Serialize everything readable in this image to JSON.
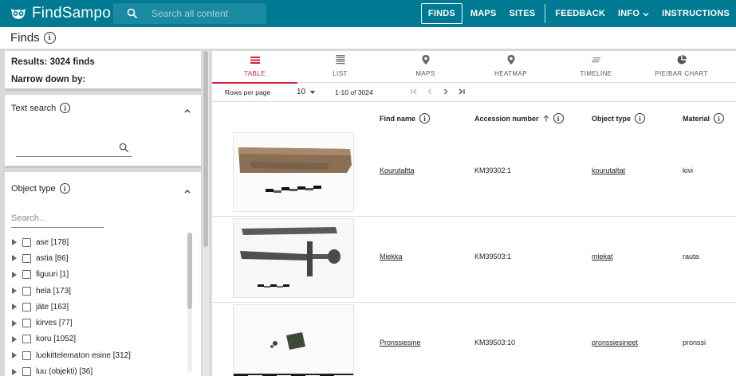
{
  "header": {
    "brand": "FindSampo",
    "search_placeholder": "Search all content",
    "nav": [
      {
        "label": "FINDS",
        "active": true
      },
      {
        "label": "MAPS",
        "active": false
      },
      {
        "label": "SITES",
        "active": false
      },
      {
        "label": "FEEDBACK",
        "active": false
      },
      {
        "label": "INFO",
        "active": false
      },
      {
        "label": "INSTRUCTIONS",
        "active": false
      }
    ],
    "bar_color": "#007a93"
  },
  "page": {
    "title": "Finds"
  },
  "left": {
    "results": "Results: 3024 finds",
    "narrow": "Narrow down by:",
    "text_search": {
      "title": "Text search"
    },
    "object_type": {
      "title": "Object type",
      "search_placeholder": "Search...",
      "items": [
        "ase [178]",
        "astia [86]",
        "figuuri [1]",
        "hela [173]",
        "jäte [163]",
        "kirves [77]",
        "koru [1052]",
        "luokittelematon esine [312]",
        "luu (objekti) [36]"
      ]
    }
  },
  "tabs": [
    {
      "label": "TABLE",
      "icon": "table-icon",
      "active": true
    },
    {
      "label": "LIST",
      "icon": "list-icon",
      "active": false
    },
    {
      "label": "MAPS",
      "icon": "map-pin-icon",
      "active": false
    },
    {
      "label": "HEATMAP",
      "icon": "heatmap-pin-icon",
      "active": false
    },
    {
      "label": "TIMELINE",
      "icon": "timeline-icon",
      "active": false
    },
    {
      "label": "PIE/BAR CHART",
      "icon": "pie-chart-icon",
      "active": false
    }
  ],
  "accent_color": "#d3203f",
  "pager": {
    "rows_per_page_label": "Rows per page",
    "rows_per_page": "10",
    "range": "1-10 of 3024"
  },
  "table": {
    "columns": [
      "Find name",
      "Accession number",
      "Object type",
      "Material"
    ],
    "rows": [
      {
        "name": "Kourutaltta",
        "accession": "KM39302:1",
        "type": "kourutaltat",
        "material": "kivi"
      },
      {
        "name": "Miekka",
        "accession": "KM39503:1",
        "type": "miekat",
        "material": "rauta"
      },
      {
        "name": "Pronssiesine",
        "accession": "KM39503:10",
        "type": "pronssiesineet",
        "material": "pronssi"
      }
    ]
  }
}
